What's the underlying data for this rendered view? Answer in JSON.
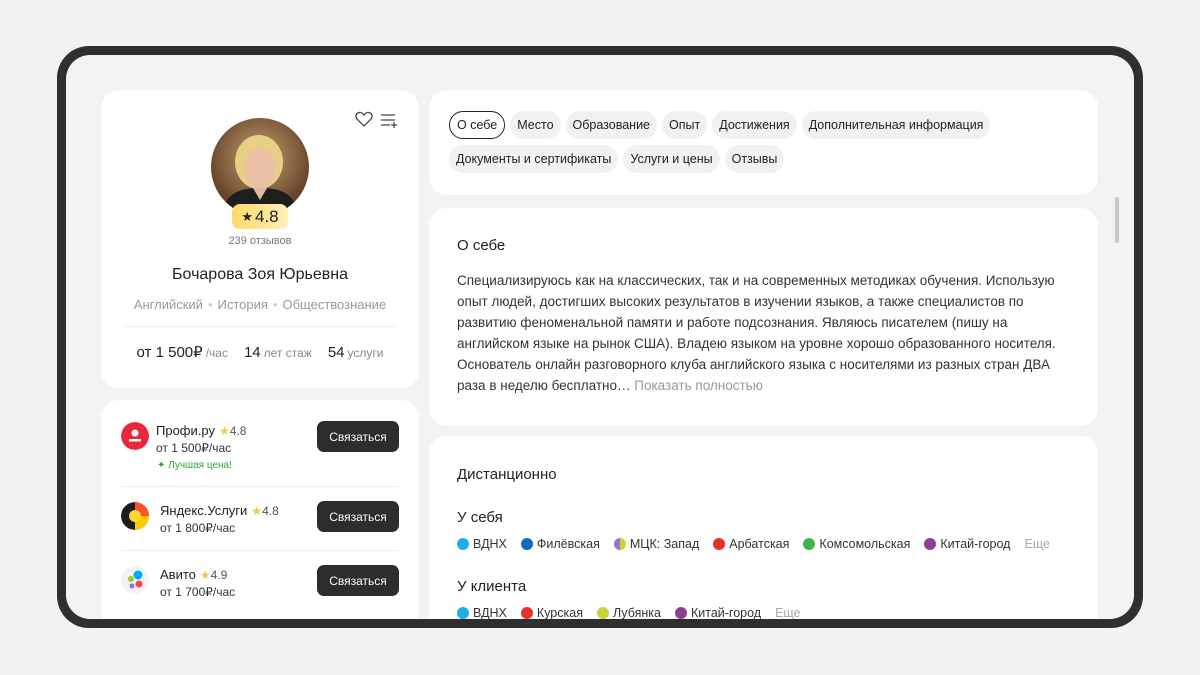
{
  "profile": {
    "rating": "4.8",
    "reviews": "239 отзывов",
    "name": "Бочарова Зоя Юрьевна",
    "subjects": [
      "Английский",
      "История",
      "Обществознание"
    ],
    "price_value": "от 1 500₽",
    "price_unit": "/час",
    "experience_value": "14",
    "experience_unit": "лет стаж",
    "services_value": "54",
    "services_unit": "услуги"
  },
  "offers": [
    {
      "name": "Профи.ру",
      "rating": "4.8",
      "price": "от 1 500₽/час",
      "badge": "Лучшая цена!",
      "button": "Связаться"
    },
    {
      "name": "Яндекс.Услуги",
      "rating": "4.8",
      "price": "от 1 800₽/час",
      "button": "Связаться"
    },
    {
      "name": "Авито",
      "rating": "4.9",
      "price": "от 1 700₽/час",
      "button": "Связаться"
    }
  ],
  "tabs": [
    "О себе",
    "Место",
    "Образование",
    "Опыт",
    "Достижения",
    "Дополнительная информация",
    "Документы и сертификаты",
    "Услуги и цены",
    "Отзывы"
  ],
  "about": {
    "title": "О себе",
    "text": "Специализируюсь как на классических, так и на современных методиках обучения. Использую опыт людей, достигших высоких результатов в изучении языков, а также специалистов по развитию феноменальной памяти и работе подсознания. Являюсь писателем (пишу на английском языке на рынок США). Владею языком на уровне хорошо образованного носителя. Основатель онлайн разговорного клуба английского языка с носителями из разных стран ДВА раза в неделю бесплатно…",
    "show_more": "Показать полностью"
  },
  "location": {
    "remote": "Дистанционно",
    "at_home_title": "У себя",
    "at_home": [
      {
        "name": "ВДНХ",
        "color": "#1ab0e8"
      },
      {
        "name": "Филёвская",
        "color": "#0a6fc2"
      },
      {
        "name": "МЦК: Запад",
        "color": "#9f6fc0"
      },
      {
        "name": "Арбатская",
        "color": "#e8312b"
      },
      {
        "name": "Комсомольская",
        "color": "#3fb44a"
      },
      {
        "name": "Китай-город",
        "color": "#8e3f8e"
      }
    ],
    "at_home_more": "Еще",
    "at_client_title": "У клиента",
    "at_client": [
      {
        "name": "ВДНХ",
        "color": "#1ab0e8"
      },
      {
        "name": "Курская",
        "color": "#e8312b"
      },
      {
        "name": "Лубянка",
        "color": "#c8d33a"
      },
      {
        "name": "Китай-город",
        "color": "#8e3f8e"
      }
    ],
    "at_client_more": "Еще"
  }
}
